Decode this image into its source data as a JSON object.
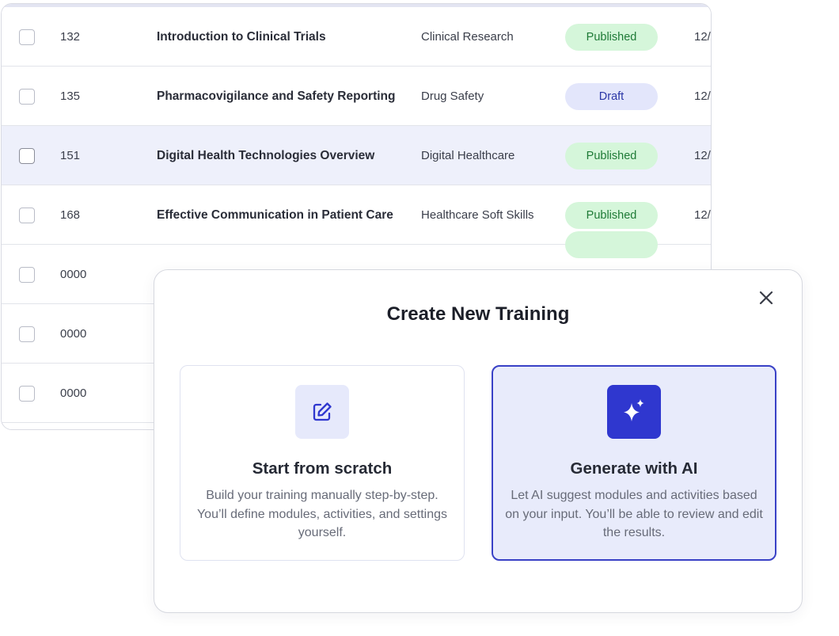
{
  "table": {
    "rows": [
      {
        "id": "132",
        "title": "Introduction to Clinical Trials",
        "category": "Clinical Research",
        "status": "Published",
        "date": "12/"
      },
      {
        "id": "135",
        "title": "Pharmacovigilance and Safety Reporting",
        "category": "Drug Safety",
        "status": "Draft",
        "date": "12/"
      },
      {
        "id": "151",
        "title": "Digital Health Technologies Overview",
        "category": "Digital Healthcare",
        "status": "Published",
        "date": "12/"
      },
      {
        "id": "168",
        "title": "Effective Communication in Patient Care",
        "category": "Healthcare Soft Skills",
        "status": "Published",
        "date": "12/"
      },
      {
        "id": "0000"
      },
      {
        "id": "0000"
      },
      {
        "id": "0000"
      }
    ]
  },
  "modal": {
    "title": "Create New Training",
    "close_icon": "close-icon",
    "options": {
      "scratch": {
        "icon": "edit-icon",
        "title": "Start from scratch",
        "description": "Build your training manually step-by-step. You’ll define modules, activities, and settings yourself."
      },
      "ai": {
        "icon": "sparkles-icon",
        "title": "Generate with AI",
        "description": "Let AI suggest modules and activities based on your input. You’ll be able to review and edit the results."
      }
    }
  },
  "colors": {
    "accent": "#2f37cf",
    "published_bg": "#d5f6da",
    "published_text": "#1e7a36",
    "draft_bg": "#e3e6fb",
    "draft_text": "#2a36a6",
    "highlight_row": "#eef0fb"
  }
}
